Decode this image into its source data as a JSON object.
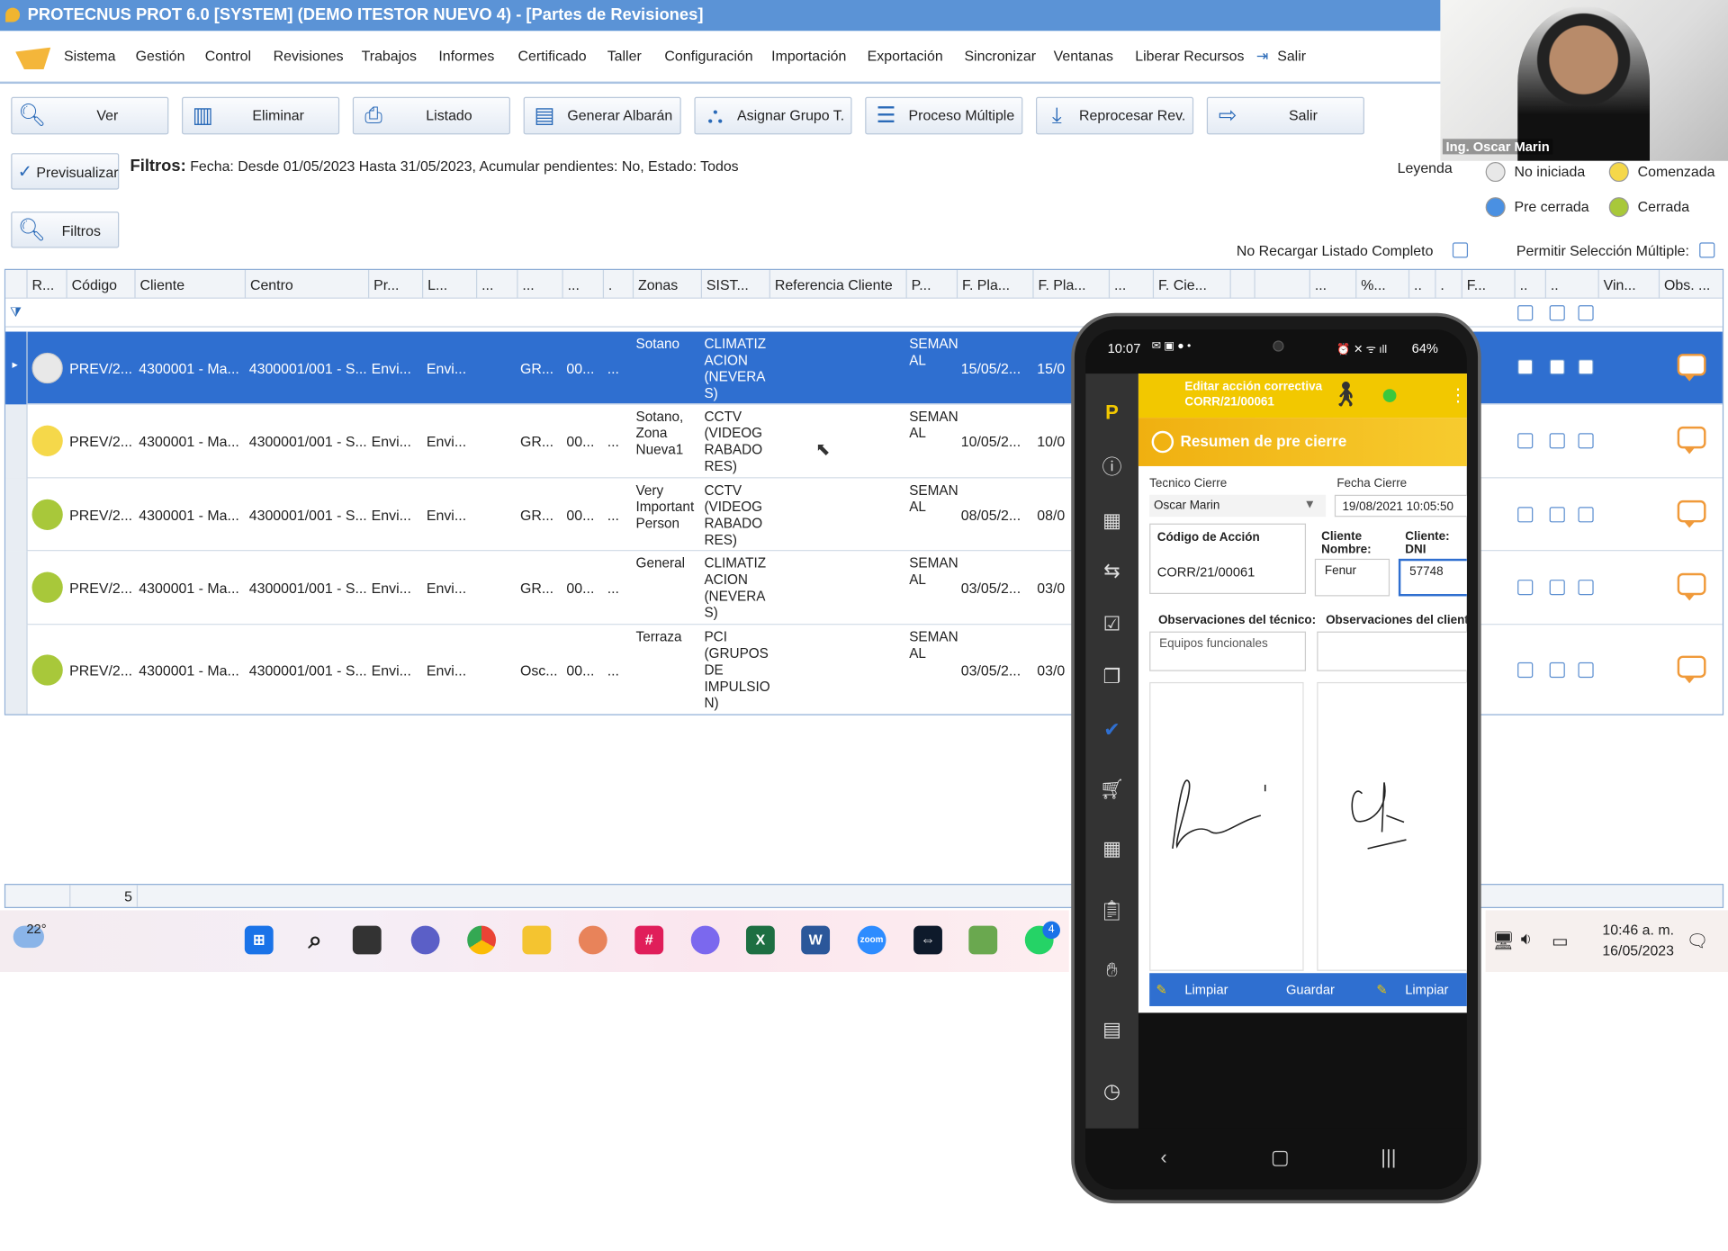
{
  "window": {
    "title": "PROTECNUS PROT 6.0 [SYSTEM] (DEMO ITESTOR NUEVO 4) - [Partes de Revisiones]"
  },
  "menu": [
    "Sistema",
    "Gestión",
    "Control",
    "Revisiones",
    "Trabajos",
    "Informes",
    "Certificado",
    "Taller",
    "Configuración",
    "Importación",
    "Exportación",
    "Sincronizar",
    "Ventanas",
    "Liberar Recursos",
    "Salir"
  ],
  "toolbar": [
    "Ver",
    "Eliminar",
    "Listado",
    "Generar Albarán",
    "Asignar Grupo T.",
    "Proceso Múltiple",
    "Reprocesar Rev.",
    "Salir"
  ],
  "preview_btn": "Previsualizar",
  "filters_btn": "Filtros",
  "filters": {
    "label": "Filtros:",
    "text": "Fecha: Desde 01/05/2023 Hasta 31/05/2023, Acumular pendientes: No, Estado: Todos"
  },
  "legend": {
    "title": "Leyenda",
    "items": [
      {
        "label": "No iniciada",
        "color": "#e8e8e8"
      },
      {
        "label": "Comenzada",
        "color": "#f5d84a"
      },
      {
        "label": "Pre cerrada",
        "color": "#4a90e2"
      },
      {
        "label": "Cerrada",
        "color": "#a8c83a"
      }
    ]
  },
  "options": {
    "no_recargar": "No Recargar Listado Completo",
    "multi": "Permitir Selección Múltiple:"
  },
  "grid": {
    "headers": [
      "R...",
      "Código",
      "Cliente",
      "Centro",
      "Pr...",
      "L...",
      "...",
      "...",
      "...",
      ".",
      "Zonas",
      "SIST...",
      "Referencia Cliente",
      "P...",
      "F. Pla...",
      "F. Pla...",
      "...",
      "F. Cie...",
      "",
      "",
      " ...",
      "%...",
      "..",
      ".",
      "F...",
      "..",
      "..",
      "Vin...",
      "Obs. ..."
    ],
    "rows": [
      {
        "status": "#e8e8e8",
        "codigo": "PREV/2...",
        "cliente": "4300001 - Ma...",
        "centro": "4300001/001 - S...",
        "pr": "Envi...",
        "l": "Envi...",
        "g": "GR...",
        "n": "00...",
        "d": "...",
        "zonas": "Sotano",
        "sist": "CLIMATIZ ACION (NEVERA S)",
        "p": "SEMAN AL",
        "f1": "15/05/2...",
        "f2": "15/0"
      },
      {
        "status": "#f5d84a",
        "codigo": "PREV/2...",
        "cliente": "4300001 - Ma...",
        "centro": "4300001/001 - S...",
        "pr": "Envi...",
        "l": "Envi...",
        "g": "GR...",
        "n": "00...",
        "d": "...",
        "zonas": "Sotano, Zona Nueva1",
        "sist": "CCTV (VIDEOG RABADO RES)",
        "p": "SEMAN AL",
        "f1": "10/05/2...",
        "f2": "10/0"
      },
      {
        "status": "#a8c83a",
        "codigo": "PREV/2...",
        "cliente": "4300001 - Ma...",
        "centro": "4300001/001 - S...",
        "pr": "Envi...",
        "l": "Envi...",
        "g": "GR...",
        "n": "00...",
        "d": "...",
        "zonas": "Very Important Person",
        "sist": "CCTV (VIDEOG RABADO RES)",
        "p": "SEMAN AL",
        "f1": "08/05/2...",
        "f2": "08/0"
      },
      {
        "status": "#a8c83a",
        "codigo": "PREV/2...",
        "cliente": "4300001 - Ma...",
        "centro": "4300001/001 - S...",
        "pr": "Envi...",
        "l": "Envi...",
        "g": "GR...",
        "n": "00...",
        "d": "...",
        "zonas": "General",
        "sist": "CLIMATIZ ACION (NEVERA S)",
        "p": "SEMAN AL",
        "f1": "03/05/2...",
        "f2": "03/0"
      },
      {
        "status": "#a8c83a",
        "codigo": "PREV/2...",
        "cliente": "4300001 - Ma...",
        "centro": "4300001/001 - S...",
        "pr": "Envi...",
        "l": "Envi...",
        "g": "Osc...",
        "n": "00...",
        "d": "...",
        "zonas": "Terraza",
        "sist": "PCI (GRUPOS DE IMPULSIO N)",
        "p": "SEMAN AL",
        "f1": "03/05/2...",
        "f2": "03/0"
      }
    ],
    "count": "5"
  },
  "taskbar": {
    "temp": "22°",
    "time": "10:46 a. m.",
    "date": "16/05/2023",
    "badge": "4"
  },
  "webcam": {
    "name": "Ing. Oscar Marin"
  },
  "phone": {
    "time": "10:07",
    "battery": "64%",
    "header_title": "Editar acción correctiva",
    "header_code": "CORR/21/00061",
    "section": "Resumen de pre cierre",
    "tecnico_label": "Tecnico Cierre",
    "tecnico_value": "Oscar Marin",
    "fecha_label": "Fecha Cierre",
    "fecha_value": "19/08/2021 10:05:50",
    "codigo_label": "Código de Acción",
    "codigo_value": "CORR/21/00061",
    "cliente_nombre_label": "Cliente Nombre:",
    "cliente_nombre_value": "Fenur",
    "cliente_dni_label": "Cliente: DNI",
    "cliente_dni_value": "57748",
    "obs_tecnico_label": "Observaciones del técnico:",
    "obs_tecnico_value": "Equipos funcionales",
    "obs_cliente_label": "Observaciones del cliente:",
    "btn_limpiar1": "Limpiar",
    "btn_guardar": "Guardar",
    "btn_limpiar2": "Limpiar"
  }
}
